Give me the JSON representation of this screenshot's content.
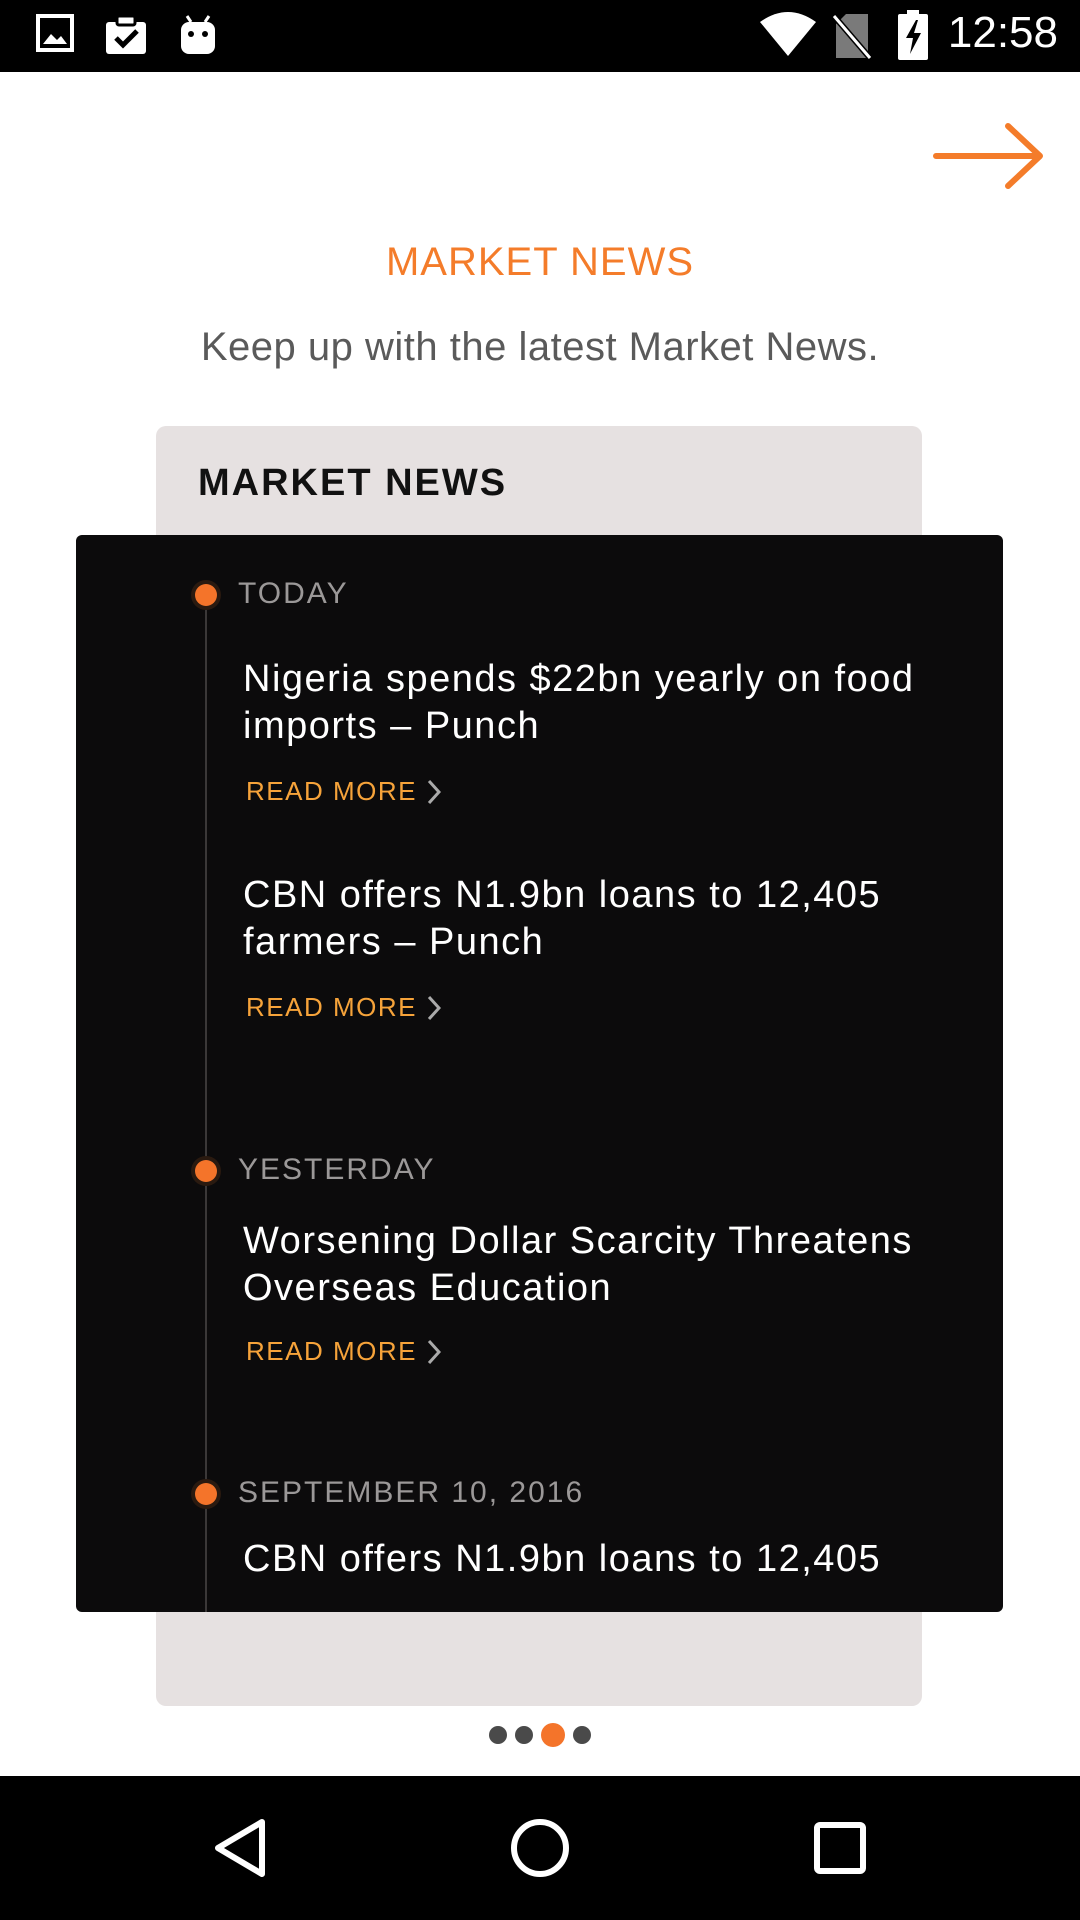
{
  "status_bar": {
    "time": "12:58",
    "left_icons": [
      "image-icon",
      "clipboard-check-icon",
      "android-icon"
    ],
    "right_icons": [
      "wifi-icon",
      "no-sim-icon",
      "battery-charging-icon"
    ]
  },
  "onboarding": {
    "title": "MARKET NEWS",
    "subtitle": "Keep up with the latest Market News.",
    "next_icon": "arrow-right-icon",
    "accent_color": "#f47c2a"
  },
  "card": {
    "title": "MARKET NEWS",
    "groups": [
      {
        "date": "TODAY",
        "items": [
          {
            "headline": "Nigeria spends $22bn yearly on food imports – Punch",
            "read_more": "READ MORE"
          },
          {
            "headline": "CBN offers N1.9bn loans to 12,405 farmers – Punch",
            "read_more": "READ MORE"
          }
        ]
      },
      {
        "date": "YESTERDAY",
        "items": [
          {
            "headline": "Worsening Dollar Scarcity Threatens Overseas Education",
            "read_more": "READ MORE"
          }
        ]
      },
      {
        "date": "SEPTEMBER 10, 2016",
        "items": [
          {
            "headline": "CBN offers N1.9bn loans to 12,405"
          }
        ]
      }
    ]
  },
  "pager": {
    "count": 4,
    "active_index": 2
  },
  "nav_bar": {
    "buttons": [
      "back-icon",
      "home-icon",
      "recents-icon"
    ]
  }
}
